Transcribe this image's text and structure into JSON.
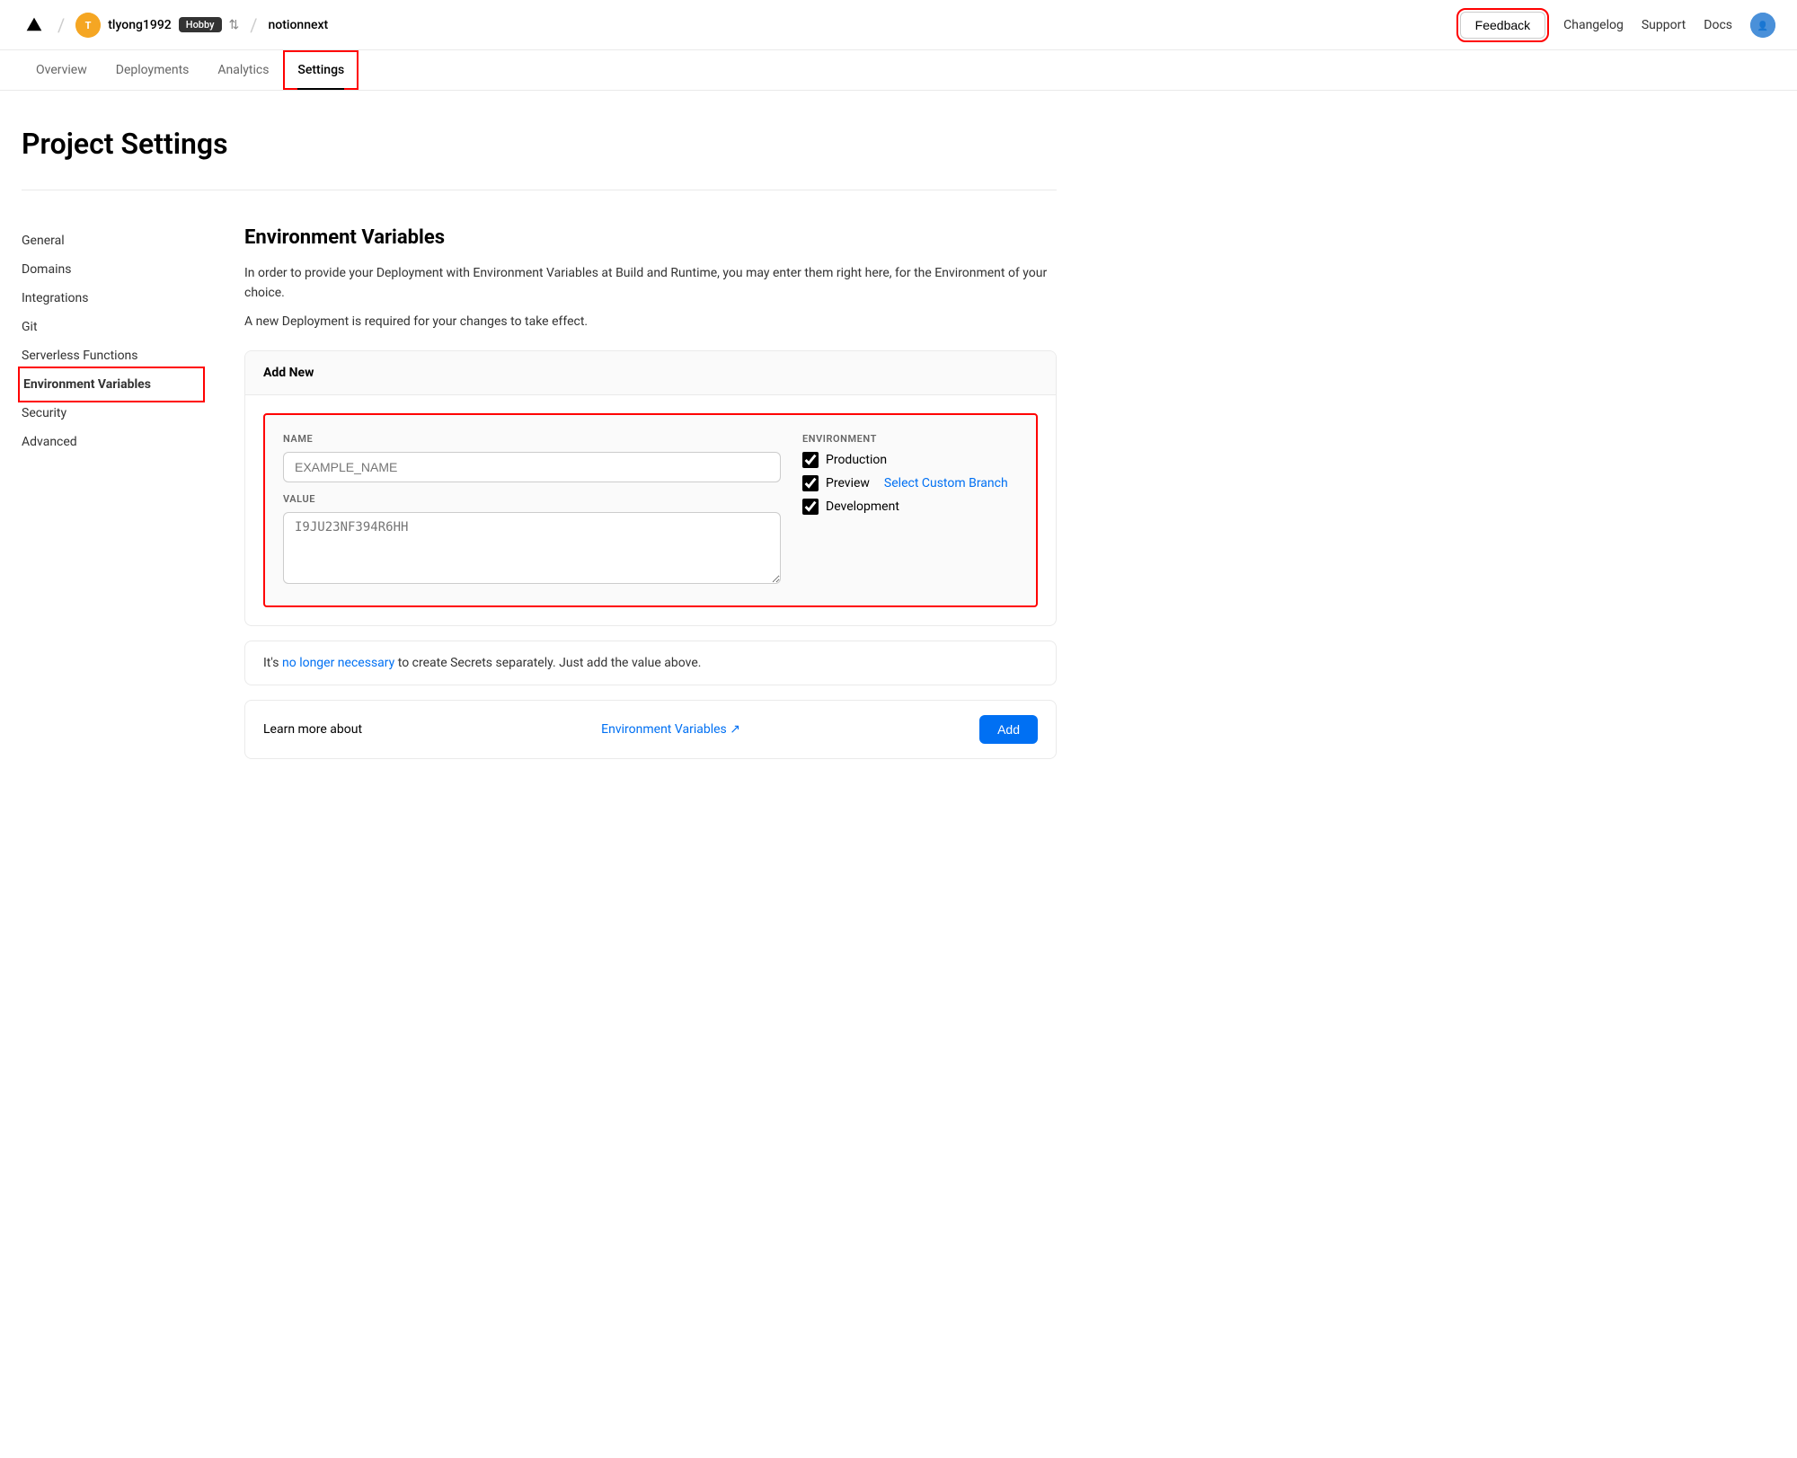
{
  "header": {
    "logo_label": "▲",
    "user": {
      "username": "tlyong1992",
      "plan": "Hobby",
      "avatar_text": "T"
    },
    "project": "notionnext",
    "feedback_label": "Feedback",
    "changelog_label": "Changelog",
    "support_label": "Support",
    "docs_label": "Docs"
  },
  "sub_nav": {
    "items": [
      {
        "label": "Overview",
        "active": false
      },
      {
        "label": "Deployments",
        "active": false
      },
      {
        "label": "Analytics",
        "active": false
      },
      {
        "label": "Settings",
        "active": true
      }
    ]
  },
  "page": {
    "title": "Project Settings"
  },
  "sidebar": {
    "items": [
      {
        "label": "General",
        "active": false
      },
      {
        "label": "Domains",
        "active": false
      },
      {
        "label": "Integrations",
        "active": false
      },
      {
        "label": "Git",
        "active": false
      },
      {
        "label": "Serverless Functions",
        "active": false
      },
      {
        "label": "Environment Variables",
        "active": true
      },
      {
        "label": "Security",
        "active": false
      },
      {
        "label": "Advanced",
        "active": false
      }
    ]
  },
  "env_vars": {
    "section_title": "Environment Variables",
    "description1": "In order to provide your Deployment with Environment Variables at Build and Runtime, you may enter them right here, for the Environment of your choice.",
    "description2": "A new Deployment is required for your changes to take effect.",
    "add_new_label": "Add New",
    "name_label": "NAME",
    "name_placeholder": "EXAMPLE_NAME",
    "value_label": "VALUE",
    "value_placeholder": "I9JU23NF394R6HH",
    "environment_label": "ENVIRONMENT",
    "env_options": [
      {
        "label": "Production",
        "checked": true
      },
      {
        "label": "Preview",
        "checked": true
      },
      {
        "label": "Development",
        "checked": true
      }
    ],
    "select_custom_branch": "Select Custom Branch",
    "info_text_pre": "It's ",
    "info_link": "no longer necessary",
    "info_text_post": " to create Secrets separately. Just add the value above.",
    "learn_more_pre": "Learn more about ",
    "learn_more_link": "Environment Variables",
    "learn_more_icon": "↗",
    "add_button_label": "Add"
  }
}
